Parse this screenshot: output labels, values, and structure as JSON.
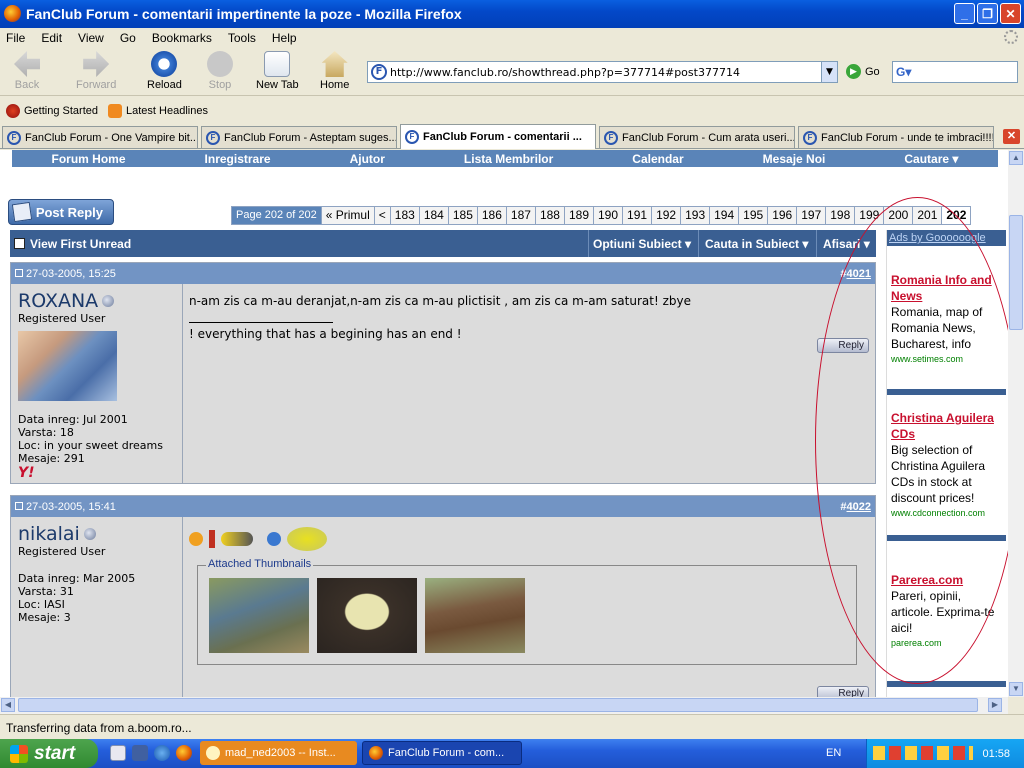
{
  "window": {
    "title": "FanClub Forum - comentarii impertinente la poze - Mozilla Firefox"
  },
  "menu": [
    "File",
    "Edit",
    "View",
    "Go",
    "Bookmarks",
    "Tools",
    "Help"
  ],
  "toolbar": {
    "back": "Back",
    "forward": "Forward",
    "reload": "Reload",
    "stop": "Stop",
    "new_tab": "New Tab",
    "home": "Home",
    "go": "Go"
  },
  "address": {
    "url": "http://www.fanclub.ro/showthread.php?p=377714#post377714"
  },
  "bookmarks": [
    "Getting Started",
    "Latest Headlines"
  ],
  "tabs": [
    {
      "label": "FanClub Forum - One Vampire bit..."
    },
    {
      "label": "FanClub Forum - Asteptam suges..."
    },
    {
      "label": "FanClub Forum - comentarii ..."
    },
    {
      "label": "FanClub Forum - Cum arata useri..."
    },
    {
      "label": "FanClub Forum - unde te imbraci!!!!"
    }
  ],
  "forum_nav": [
    "Forum Home",
    "Inregistrare",
    "Ajutor",
    "Lista Membrilor",
    "Calendar",
    "Mesaje Noi",
    "Cautare"
  ],
  "post_reply": "Post Reply",
  "pager": {
    "label": "Page 202 of 202",
    "first": "« Primul",
    "prev": "<",
    "pages": [
      "183",
      "184",
      "185",
      "186",
      "187",
      "188",
      "189",
      "190",
      "191",
      "192",
      "193",
      "194",
      "195",
      "196",
      "197",
      "198",
      "199",
      "200",
      "201",
      "202"
    ]
  },
  "thread_controls": {
    "view_first_unread": "View First Unread",
    "options": "Optiuni Subiect",
    "search": "Cauta in Subiect",
    "display": "Afisari"
  },
  "posts": [
    {
      "date": "27-03-2005, 15:25",
      "number": "4021",
      "user": "ROXANA",
      "title": "Registered User",
      "join": "Data inreg: Jul 2001",
      "age": "Varsta: 18",
      "loc": "Loc: in your sweet dreams",
      "posts": "Mesaje: 291",
      "message": "n-am zis ca m-au deranjat,n-am zis ca m-au plictisit , am zis ca m-am saturat! zbye",
      "signature": "! everything that has a begining has an end !",
      "reply": "Reply"
    },
    {
      "date": "27-03-2005, 15:41",
      "number": "4022",
      "user": "nikalai",
      "title": "Registered User",
      "join": "Data inreg: Mar 2005",
      "age": "Varsta: 31",
      "loc": "Loc: IASI",
      "posts": "Mesaje: 3",
      "attachments": "Attached Thumbnails",
      "reply": "Reply"
    }
  ],
  "ads": {
    "header": "Ads by Goooooogle",
    "items": [
      {
        "title": "Romania Info and News",
        "body": "Romania, map of Romania News, Bucharest, info",
        "url": "www.setimes.com"
      },
      {
        "title": "Christina Aguilera CDs",
        "body": "Big selection of Christina Aguilera CDs in stock at discount prices!",
        "url": "www.cdconnection.com"
      },
      {
        "title": "Parerea.com",
        "body": "Pareri, opinii, articole. Exprima-te aici!",
        "url": "parerea.com"
      }
    ]
  },
  "status": "Transferring data from a.boom.ro...",
  "taskbar": {
    "start": "start",
    "tasks": [
      "mad_ned2003 -- Inst...",
      "FanClub Forum - com..."
    ],
    "lang": "EN",
    "clock": "01:58"
  }
}
